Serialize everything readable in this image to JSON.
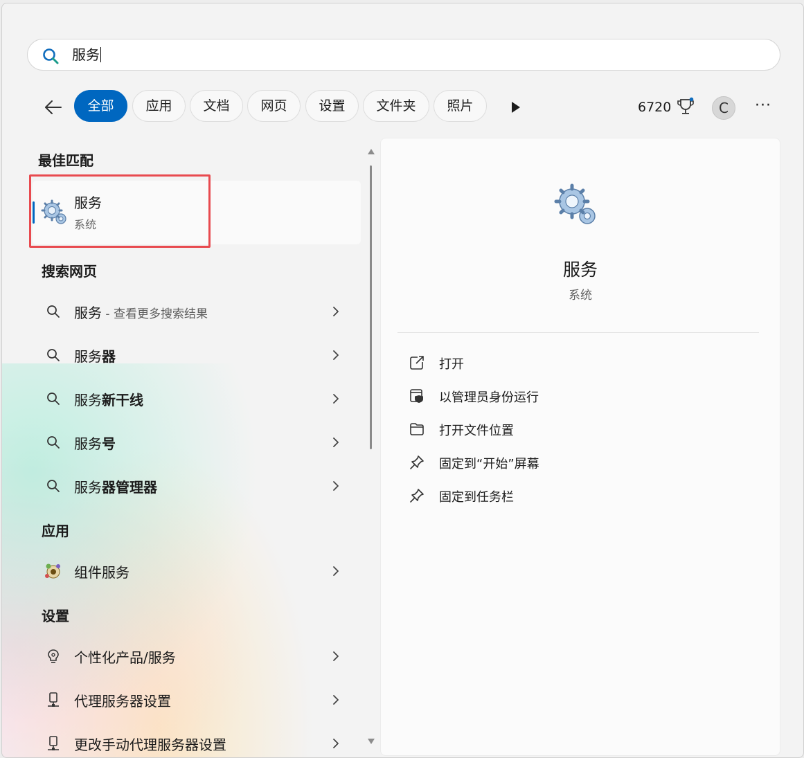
{
  "search": {
    "query": "服务"
  },
  "filters": {
    "back_icon": "back-arrow-icon",
    "chips": [
      {
        "label": "全部",
        "active": true
      },
      {
        "label": "应用"
      },
      {
        "label": "文档"
      },
      {
        "label": "网页"
      },
      {
        "label": "设置"
      },
      {
        "label": "文件夹"
      },
      {
        "label": "照片"
      }
    ],
    "more_filters_icon": "play-icon",
    "points": "6720",
    "points_icon": "trophy-icon",
    "avatar_initial": "C",
    "more_icon": "ellipsis-icon",
    "more_label": "···"
  },
  "best_match": {
    "heading": "最佳匹配",
    "title": "服务",
    "subtitle": "系统",
    "icon": "gears-icon"
  },
  "web_search": {
    "heading": "搜索网页",
    "items": [
      {
        "prefix": "服务",
        "suffix_bold": "",
        "hint": " - 查看更多搜索结果"
      },
      {
        "prefix": "服务",
        "suffix_bold": "器",
        "hint": ""
      },
      {
        "prefix": "服务",
        "suffix_bold": "新干线",
        "hint": ""
      },
      {
        "prefix": "服务",
        "suffix_bold": "号",
        "hint": ""
      },
      {
        "prefix": "服务",
        "suffix_bold": "器管理器",
        "hint": ""
      }
    ]
  },
  "apps": {
    "heading": "应用",
    "items": [
      {
        "label": "组件服务",
        "icon": "component-services-icon"
      }
    ]
  },
  "settings": {
    "heading": "设置",
    "items": [
      {
        "label": "个性化产品/服务",
        "icon": "lightbulb-icon"
      },
      {
        "label": "代理服务器设置",
        "icon": "proxy-icon"
      },
      {
        "label": "更改手动代理服务器设置",
        "icon": "proxy-icon"
      }
    ]
  },
  "detail": {
    "title": "服务",
    "subtitle": "系统",
    "icon": "gears-icon",
    "actions": [
      {
        "label": "打开",
        "icon": "open-external-icon"
      },
      {
        "label": "以管理员身份运行",
        "icon": "shield-icon"
      },
      {
        "label": "打开文件位置",
        "icon": "folder-icon"
      },
      {
        "label": "固定到“开始”屏幕",
        "icon": "pin-icon"
      },
      {
        "label": "固定到任务栏",
        "icon": "pin-icon"
      }
    ]
  },
  "colors": {
    "accent": "#0067c0",
    "highlight": "#e84a4f"
  }
}
